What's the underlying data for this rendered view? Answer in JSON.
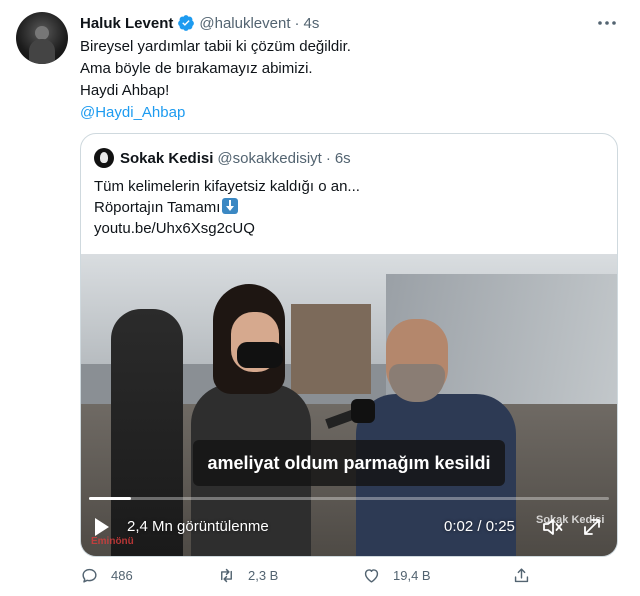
{
  "author": {
    "name": "Haluk Levent",
    "handle": "@haluklevent",
    "separator": "·",
    "time": "4s"
  },
  "tweet": {
    "lines": [
      "Bireysel yardımlar tabii ki çözüm değildir.",
      "Ama böyle de bırakamayız abimizi.",
      "Haydi Ahbap!"
    ],
    "mention": "@Haydi_Ahbap"
  },
  "quote": {
    "name": "Sokak Kedisi",
    "handle": "@sokakkedisiyt",
    "separator": "·",
    "time": "6s",
    "line1": "Tüm kelimelerin kifayetsiz kaldığı o an...",
    "line2": "Röportajın Tamamı",
    "link": "youtu.be/Uhx6Xsg2cUQ"
  },
  "video": {
    "subtitle": "ameliyat oldum parmağım kesildi",
    "views": "2,4 Mn görüntülenme",
    "timecode": "0:02 / 0:25",
    "progress": 0.08,
    "watermark_right": "Sokak Kedisi",
    "watermark_left": "Eminönü"
  },
  "actions": {
    "replies": "486",
    "retweets": "2,3 B",
    "likes": "19,4 B"
  },
  "colors": {
    "accent": "#1d9bf0",
    "secondary_text": "#536471",
    "border": "#cfd9de"
  }
}
